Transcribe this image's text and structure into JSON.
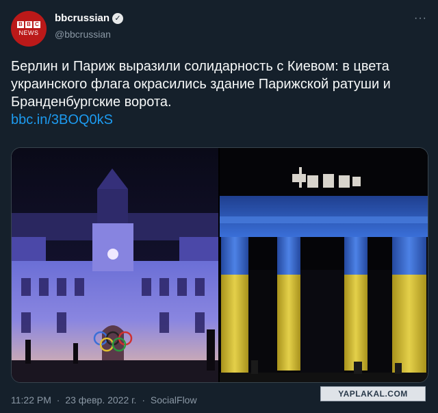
{
  "account": {
    "display_name": "bbcrussian",
    "handle": "@bbcrussian",
    "avatar_letters": [
      "B",
      "B",
      "C"
    ],
    "avatar_subtext": "NEWS",
    "verified_glyph": "✓"
  },
  "menu": {
    "more_glyph": "···"
  },
  "tweet": {
    "text": "Берлин и Париж выразили солидарность с Киевом: в цвета украинского флага окрасились здание Парижской ратуши и Бранденбургские ворота.",
    "link": "bbc.in/3BOQ0kS"
  },
  "meta": {
    "time": "11:22 PM",
    "date": "23 февр. 2022 г.",
    "separator": "·",
    "source": "SocialFlow"
  },
  "watermark": "YAPLAKAL.COM",
  "colors": {
    "background": "#15202b",
    "link": "#1d9bf0",
    "muted": "#8b98a5",
    "bbc_red": "#bb1919",
    "ukraine_blue": "#2f5fc8",
    "ukraine_yellow": "#d8c23a"
  },
  "images": [
    {
      "subject": "paris-city-hall-illuminated"
    },
    {
      "subject": "brandenburg-gate-illuminated"
    }
  ]
}
